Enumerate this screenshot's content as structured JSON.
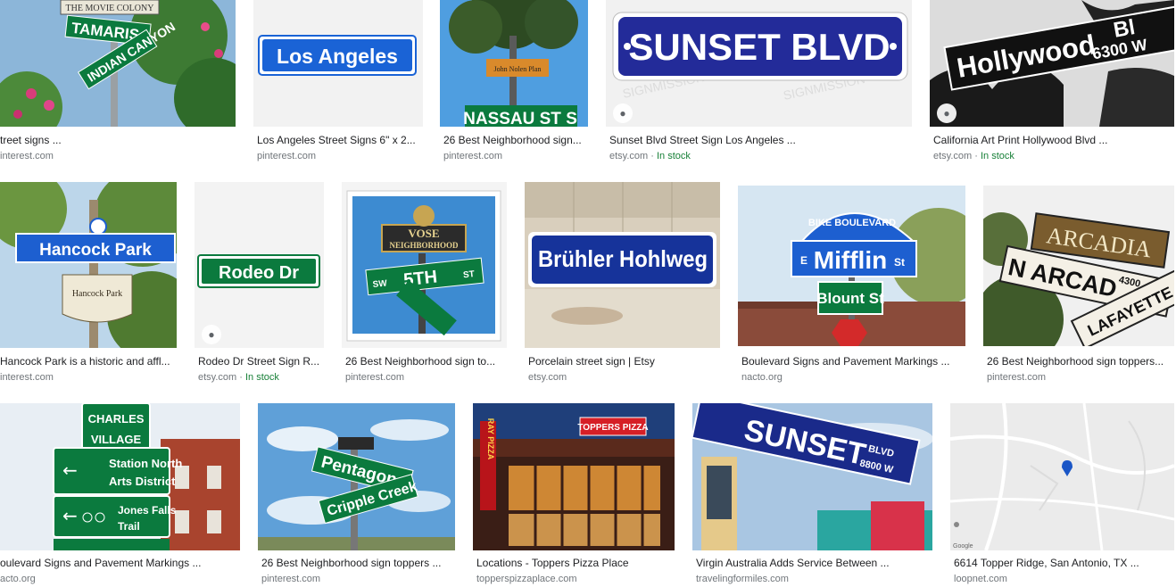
{
  "results": [
    {
      "title": "treet signs ...",
      "source": "interest.com",
      "stock": "",
      "stock_sep": ""
    },
    {
      "title": "Los Angeles Street Signs 6\" x 2...",
      "source": "pinterest.com",
      "stock": "",
      "stock_sep": ""
    },
    {
      "title": "26 Best Neighborhood sign...",
      "source": "pinterest.com",
      "stock": "",
      "stock_sep": ""
    },
    {
      "title": "Sunset Blvd Street Sign Los Angeles ...",
      "source": "etsy.com",
      "stock": "In stock",
      "stock_sep": " · "
    },
    {
      "title": "California Art Print Hollywood Blvd ...",
      "source": "etsy.com",
      "stock": "In stock",
      "stock_sep": " · "
    },
    {
      "title": "Hancock Park is a historic and affl...",
      "source": "interest.com",
      "stock": "",
      "stock_sep": ""
    },
    {
      "title": "Rodeo Dr Street Sign R...",
      "source": "etsy.com",
      "stock": "In stock",
      "stock_sep": " · "
    },
    {
      "title": "26 Best Neighborhood sign to...",
      "source": "pinterest.com",
      "stock": "",
      "stock_sep": ""
    },
    {
      "title": "Porcelain street sign | Etsy",
      "source": "etsy.com",
      "stock": "",
      "stock_sep": ""
    },
    {
      "title": "Boulevard Signs and Pavement Markings ...",
      "source": "nacto.org",
      "stock": "",
      "stock_sep": ""
    },
    {
      "title": "26 Best Neighborhood sign toppers...",
      "source": "pinterest.com",
      "stock": "",
      "stock_sep": ""
    },
    {
      "title": "oulevard Signs and Pavement Markings ...",
      "source": "acto.org",
      "stock": "",
      "stock_sep": ""
    },
    {
      "title": "26 Best Neighborhood sign toppers ...",
      "source": "pinterest.com",
      "stock": "",
      "stock_sep": ""
    },
    {
      "title": "Locations - Toppers Pizza Place",
      "source": "topperspizzaplace.com",
      "stock": "",
      "stock_sep": ""
    },
    {
      "title": "Virgin Australia Adds Service Between ...",
      "source": "travelingformiles.com",
      "stock": "",
      "stock_sep": ""
    },
    {
      "title": "6614 Topper Ridge, San Antonio, TX ...",
      "source": "loopnet.com",
      "stock": "",
      "stock_sep": ""
    }
  ],
  "image_text": {
    "movie_colony": "THE MOVIE COLONY",
    "tamarisk": "TAMARIS",
    "indian_canyon": "INDIAN CANYON",
    "los_angeles": "Los Angeles",
    "john_nolen": "John Nolen Plan",
    "nassau": "NASSAU ST S",
    "sunset_blvd": "SUNSET BLVD",
    "watermark": "SIGNMISSION",
    "hollywood": "Hollywood",
    "hollywood_bl": "Bl",
    "hollywood_num": "6300 W",
    "hancock_park": "Hancock Park",
    "hancock_small": "Hancock Park",
    "rodeo": "Rodeo Dr",
    "vose": "VOSE",
    "neighborhood": "NEIGHBORHOOD",
    "fifth": "5TH",
    "sw": "SW",
    "st": "ST",
    "bruhler": "Brühler Hohlweg",
    "bike_boulevard": "BIKE BOULEVARD",
    "mifflin": "Mifflin",
    "mifflin_e": "E",
    "mifflin_st": "St",
    "blount": "Blount St",
    "arcadia": "ARCADIA",
    "n_arcad": "N ARCAD",
    "n4300": "4300",
    "lafayette": "LAFAYETTE BLVD",
    "charles": "CHARLES",
    "village": "VILLAGE",
    "station_north": "Station North",
    "arts_district": "Arts District",
    "jones_falls": "Jones Falls",
    "trail": "Trail",
    "pentagon": "Pentagon",
    "cripple_creek": "Cripple Creek",
    "toppers_pizza": "TOPPERS PIZZA",
    "ray_pizza": "RAY PIZZA",
    "sunset": "SUNSET",
    "blvd_small": "BLVD",
    "n8800": "8800 W",
    "google": "Google"
  },
  "colors": {
    "caption": "#202124",
    "source": "#70757a",
    "in_stock": "#188038",
    "sign_blue": "#1d5fd0",
    "sign_green": "#0b7a3e"
  }
}
